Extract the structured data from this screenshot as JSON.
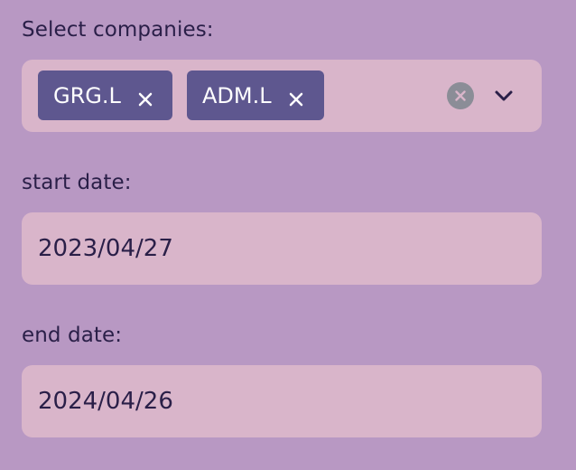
{
  "companies": {
    "label": "Select companies:",
    "selected": [
      {
        "ticker": "GRG.L"
      },
      {
        "ticker": "ADM.L"
      }
    ],
    "clear_icon": "clear-all-icon",
    "dropdown_icon": "chevron-down-icon"
  },
  "start_date": {
    "label": "start date:",
    "value": "2023/04/27"
  },
  "end_date": {
    "label": "end date:",
    "value": "2024/04/26"
  },
  "colors": {
    "background": "#b898c3",
    "input_background": "#d9b5ca",
    "chip_background": "#5e578f",
    "text": "#2a1f48",
    "clear_icon": "#8b8d97"
  }
}
